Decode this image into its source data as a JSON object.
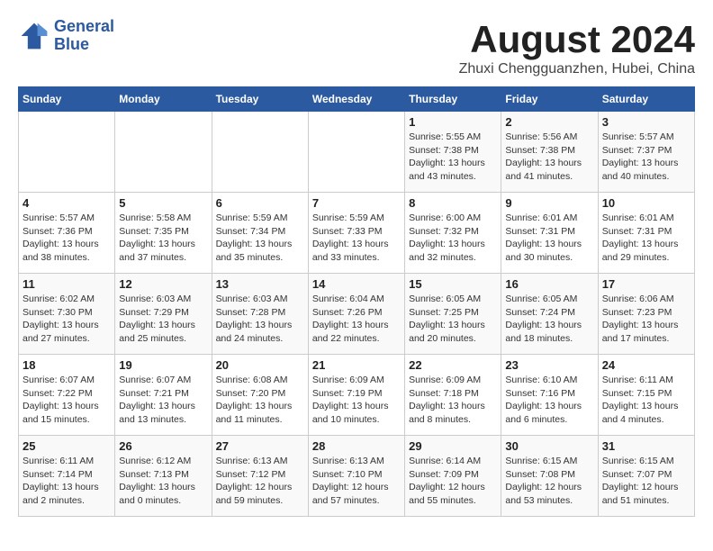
{
  "header": {
    "logo_line1": "General",
    "logo_line2": "Blue",
    "title": "August 2024",
    "subtitle": "Zhuxi Chengguanzhen, Hubei, China"
  },
  "days_of_week": [
    "Sunday",
    "Monday",
    "Tuesday",
    "Wednesday",
    "Thursday",
    "Friday",
    "Saturday"
  ],
  "weeks": [
    [
      {
        "num": "",
        "info": ""
      },
      {
        "num": "",
        "info": ""
      },
      {
        "num": "",
        "info": ""
      },
      {
        "num": "",
        "info": ""
      },
      {
        "num": "1",
        "info": "Sunrise: 5:55 AM\nSunset: 7:38 PM\nDaylight: 13 hours\nand 43 minutes."
      },
      {
        "num": "2",
        "info": "Sunrise: 5:56 AM\nSunset: 7:38 PM\nDaylight: 13 hours\nand 41 minutes."
      },
      {
        "num": "3",
        "info": "Sunrise: 5:57 AM\nSunset: 7:37 PM\nDaylight: 13 hours\nand 40 minutes."
      }
    ],
    [
      {
        "num": "4",
        "info": "Sunrise: 5:57 AM\nSunset: 7:36 PM\nDaylight: 13 hours\nand 38 minutes."
      },
      {
        "num": "5",
        "info": "Sunrise: 5:58 AM\nSunset: 7:35 PM\nDaylight: 13 hours\nand 37 minutes."
      },
      {
        "num": "6",
        "info": "Sunrise: 5:59 AM\nSunset: 7:34 PM\nDaylight: 13 hours\nand 35 minutes."
      },
      {
        "num": "7",
        "info": "Sunrise: 5:59 AM\nSunset: 7:33 PM\nDaylight: 13 hours\nand 33 minutes."
      },
      {
        "num": "8",
        "info": "Sunrise: 6:00 AM\nSunset: 7:32 PM\nDaylight: 13 hours\nand 32 minutes."
      },
      {
        "num": "9",
        "info": "Sunrise: 6:01 AM\nSunset: 7:31 PM\nDaylight: 13 hours\nand 30 minutes."
      },
      {
        "num": "10",
        "info": "Sunrise: 6:01 AM\nSunset: 7:31 PM\nDaylight: 13 hours\nand 29 minutes."
      }
    ],
    [
      {
        "num": "11",
        "info": "Sunrise: 6:02 AM\nSunset: 7:30 PM\nDaylight: 13 hours\nand 27 minutes."
      },
      {
        "num": "12",
        "info": "Sunrise: 6:03 AM\nSunset: 7:29 PM\nDaylight: 13 hours\nand 25 minutes."
      },
      {
        "num": "13",
        "info": "Sunrise: 6:03 AM\nSunset: 7:28 PM\nDaylight: 13 hours\nand 24 minutes."
      },
      {
        "num": "14",
        "info": "Sunrise: 6:04 AM\nSunset: 7:26 PM\nDaylight: 13 hours\nand 22 minutes."
      },
      {
        "num": "15",
        "info": "Sunrise: 6:05 AM\nSunset: 7:25 PM\nDaylight: 13 hours\nand 20 minutes."
      },
      {
        "num": "16",
        "info": "Sunrise: 6:05 AM\nSunset: 7:24 PM\nDaylight: 13 hours\nand 18 minutes."
      },
      {
        "num": "17",
        "info": "Sunrise: 6:06 AM\nSunset: 7:23 PM\nDaylight: 13 hours\nand 17 minutes."
      }
    ],
    [
      {
        "num": "18",
        "info": "Sunrise: 6:07 AM\nSunset: 7:22 PM\nDaylight: 13 hours\nand 15 minutes."
      },
      {
        "num": "19",
        "info": "Sunrise: 6:07 AM\nSunset: 7:21 PM\nDaylight: 13 hours\nand 13 minutes."
      },
      {
        "num": "20",
        "info": "Sunrise: 6:08 AM\nSunset: 7:20 PM\nDaylight: 13 hours\nand 11 minutes."
      },
      {
        "num": "21",
        "info": "Sunrise: 6:09 AM\nSunset: 7:19 PM\nDaylight: 13 hours\nand 10 minutes."
      },
      {
        "num": "22",
        "info": "Sunrise: 6:09 AM\nSunset: 7:18 PM\nDaylight: 13 hours\nand 8 minutes."
      },
      {
        "num": "23",
        "info": "Sunrise: 6:10 AM\nSunset: 7:16 PM\nDaylight: 13 hours\nand 6 minutes."
      },
      {
        "num": "24",
        "info": "Sunrise: 6:11 AM\nSunset: 7:15 PM\nDaylight: 13 hours\nand 4 minutes."
      }
    ],
    [
      {
        "num": "25",
        "info": "Sunrise: 6:11 AM\nSunset: 7:14 PM\nDaylight: 13 hours\nand 2 minutes."
      },
      {
        "num": "26",
        "info": "Sunrise: 6:12 AM\nSunset: 7:13 PM\nDaylight: 13 hours\nand 0 minutes."
      },
      {
        "num": "27",
        "info": "Sunrise: 6:13 AM\nSunset: 7:12 PM\nDaylight: 12 hours\nand 59 minutes."
      },
      {
        "num": "28",
        "info": "Sunrise: 6:13 AM\nSunset: 7:10 PM\nDaylight: 12 hours\nand 57 minutes."
      },
      {
        "num": "29",
        "info": "Sunrise: 6:14 AM\nSunset: 7:09 PM\nDaylight: 12 hours\nand 55 minutes."
      },
      {
        "num": "30",
        "info": "Sunrise: 6:15 AM\nSunset: 7:08 PM\nDaylight: 12 hours\nand 53 minutes."
      },
      {
        "num": "31",
        "info": "Sunrise: 6:15 AM\nSunset: 7:07 PM\nDaylight: 12 hours\nand 51 minutes."
      }
    ]
  ]
}
